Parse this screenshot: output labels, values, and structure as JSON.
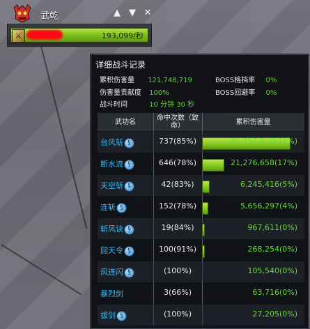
{
  "header": {
    "character_name": "武乾",
    "buttons": [
      {
        "icon": "arrow-up-icon",
        "glyph": "▲"
      },
      {
        "icon": "arrow-down-icon",
        "glyph": "▼"
      },
      {
        "icon": "close-icon",
        "glyph": "✕"
      }
    ]
  },
  "meter": {
    "dps": "193,099/秒",
    "fill_percent": 100
  },
  "details": {
    "title": "详细战斗记录",
    "stats": {
      "total_damage_label": "累积伤害量",
      "total_damage_value": "121,748,719",
      "boss_block_label": "BOSS格挡率",
      "boss_block_value": "0%",
      "contrib_label": "伤害量贡献度",
      "contrib_value": "100%",
      "boss_evade_label": "BOSS回避率",
      "boss_evade_value": "0%",
      "time_label": "战斗时间",
      "time_value": "10 分钟 30 秒"
    },
    "columns": {
      "skill": "武功名",
      "hits": "命中次数（致命）",
      "damage": "累积伤害量"
    },
    "rows": [
      {
        "skill": "台风斩",
        "hits": "737(85%)",
        "damage": "85,257,010(70%)",
        "bar_fraction": 0.7,
        "has_icon": true
      },
      {
        "skill": "断水流",
        "hits": "646(78%)",
        "damage": "21,276,658(17%)",
        "bar_fraction": 0.17,
        "has_icon": true
      },
      {
        "skill": "天空斩",
        "hits": "42(83%)",
        "damage": "6,245,416(5%)",
        "bar_fraction": 0.05,
        "has_icon": true
      },
      {
        "skill": "连斩",
        "hits": "152(78%)",
        "damage": "5,656,297(4%)",
        "bar_fraction": 0.04,
        "has_icon": true
      },
      {
        "skill": "斩风诀",
        "hits": "19(84%)",
        "damage": "967,611(0%)",
        "bar_fraction": 0.01,
        "has_icon": true
      },
      {
        "skill": "回天令",
        "hits": "100(91%)",
        "damage": "268,254(0%)",
        "bar_fraction": 0.005,
        "has_icon": true
      },
      {
        "skill": "风连闪",
        "hits": "(100%)",
        "damage": "105,540(0%)",
        "bar_fraction": 0,
        "has_icon": true
      },
      {
        "skill": "暴烈剑",
        "hits": "3(66%)",
        "damage": "63,716(0%)",
        "bar_fraction": 0,
        "has_icon": false
      },
      {
        "skill": "拔剑",
        "hits": "(100%)",
        "damage": "27,205(0%)",
        "bar_fraction": 0,
        "has_icon": true
      }
    ]
  },
  "colors": {
    "accent_green": "#86c81f",
    "skill_blue": "#39b8f0",
    "value_green": "#5ed23a",
    "redaction_red": "#ff0a14"
  }
}
